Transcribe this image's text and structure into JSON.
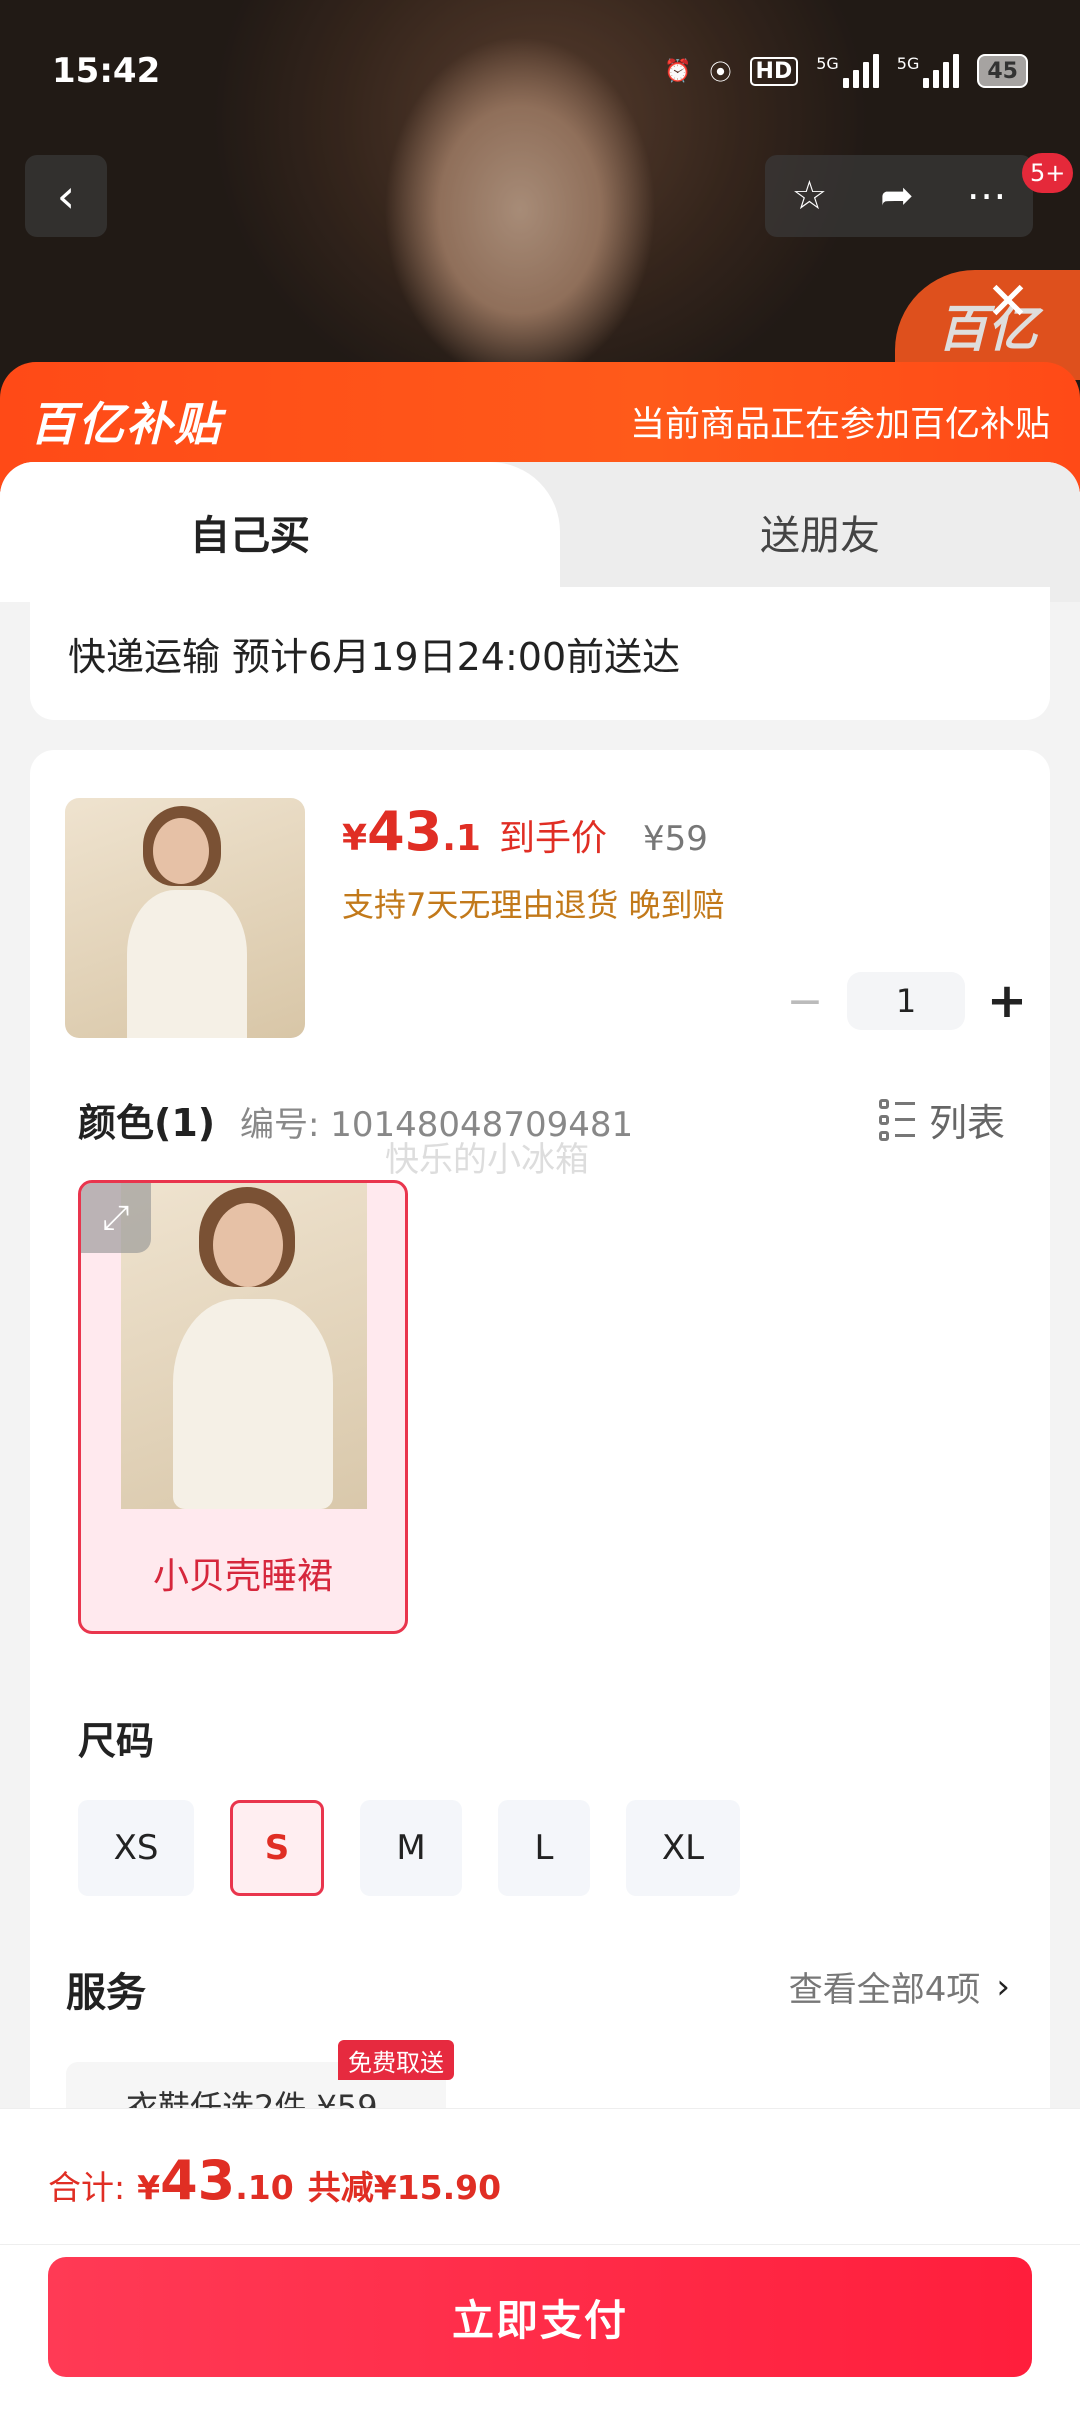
{
  "status_bar": {
    "time": "15:42",
    "network_hd": "HD",
    "net1": "5G",
    "net2": "5G",
    "battery": "45"
  },
  "nav": {
    "back_icon": "chevron-left-icon",
    "cart_badge": "5+",
    "corner_logo": "百亿"
  },
  "banner": {
    "logo": "百亿补贴",
    "text": "当前商品正在参加百亿补贴"
  },
  "tabs": [
    {
      "label": "自己买"
    },
    {
      "label": "送朋友"
    }
  ],
  "delivery": {
    "text": "快递运输 预计6月19日24:00前送达"
  },
  "product": {
    "price_currency": "¥",
    "price_int": "43",
    "price_dec": ".1",
    "price_label": "到手价",
    "original_price": "¥59",
    "promise": "支持7天无理由退货  晚到赔",
    "quantity": "1"
  },
  "color": {
    "title": "颜色(1)",
    "code_label": "编号: 10148048709481",
    "watermark": "快乐的小冰箱",
    "list_label": "列表",
    "options": [
      {
        "label": "小贝壳睡裙",
        "selected": true
      }
    ]
  },
  "size": {
    "title": "尺码",
    "options": [
      {
        "label": "XS",
        "selected": false
      },
      {
        "label": "S",
        "selected": true
      },
      {
        "label": "M",
        "selected": false
      },
      {
        "label": "L",
        "selected": false
      },
      {
        "label": "XL",
        "selected": false
      }
    ]
  },
  "service": {
    "title": "服务",
    "view_all": "查看全部4项",
    "chip_text": "衣鞋任选2件  ¥59",
    "chip_tag": "免费取送"
  },
  "bottom": {
    "total_label": "合计:",
    "currency": "¥",
    "total_int": "43",
    "total_dec": ".10",
    "saved": "共减¥15.90",
    "pay_button": "立即支付"
  },
  "colors": {
    "accent_red": "#e02e24",
    "banner_orange": "#ff4a17",
    "pay_button": "#ff1e3c"
  }
}
